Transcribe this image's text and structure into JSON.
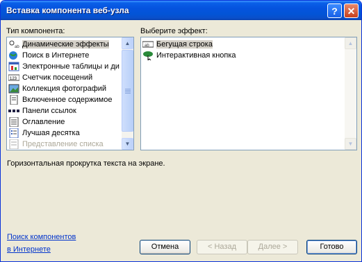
{
  "window": {
    "title": "Вставка компонента веб-узла",
    "help_label": "?",
    "close_label": "✕"
  },
  "left": {
    "label": "Тип компонента:",
    "items": [
      {
        "label": "Динамические эффекты",
        "icon": "dynamic-effects-icon",
        "selected": true
      },
      {
        "label": "Поиск в Интернете",
        "icon": "web-search-icon"
      },
      {
        "label": "Электронные таблицы и ди",
        "icon": "spreadsheet-icon"
      },
      {
        "label": "Счетчик посещений",
        "icon": "hit-counter-icon"
      },
      {
        "label": "Коллекция фотографий",
        "icon": "photo-gallery-icon"
      },
      {
        "label": "Включенное содержимое",
        "icon": "included-content-icon"
      },
      {
        "label": "Панели ссылок",
        "icon": "link-bar-icon"
      },
      {
        "label": "Оглавление",
        "icon": "table-of-contents-icon"
      },
      {
        "label": "Лучшая десятка",
        "icon": "top-ten-icon"
      },
      {
        "label": "Представление списка",
        "icon": "list-view-icon",
        "disabled": true
      }
    ]
  },
  "right": {
    "label": "Выберите эффект:",
    "items": [
      {
        "label": "Бегущая строка",
        "icon": "marquee-icon",
        "selected": true
      },
      {
        "label": "Интерактивная кнопка",
        "icon": "interactive-button-icon"
      }
    ]
  },
  "description": "Горизонтальная прокрутка текста на экране.",
  "links": {
    "line1": "Поиск компонентов",
    "line2": "в Интернете"
  },
  "buttons": {
    "cancel": "Отмена",
    "back": "< Назад",
    "next": "Далее >",
    "finish": "Готово"
  },
  "colors": {
    "titlebar": "#0553de",
    "link": "#0033cc",
    "face": "#ece9d8"
  }
}
